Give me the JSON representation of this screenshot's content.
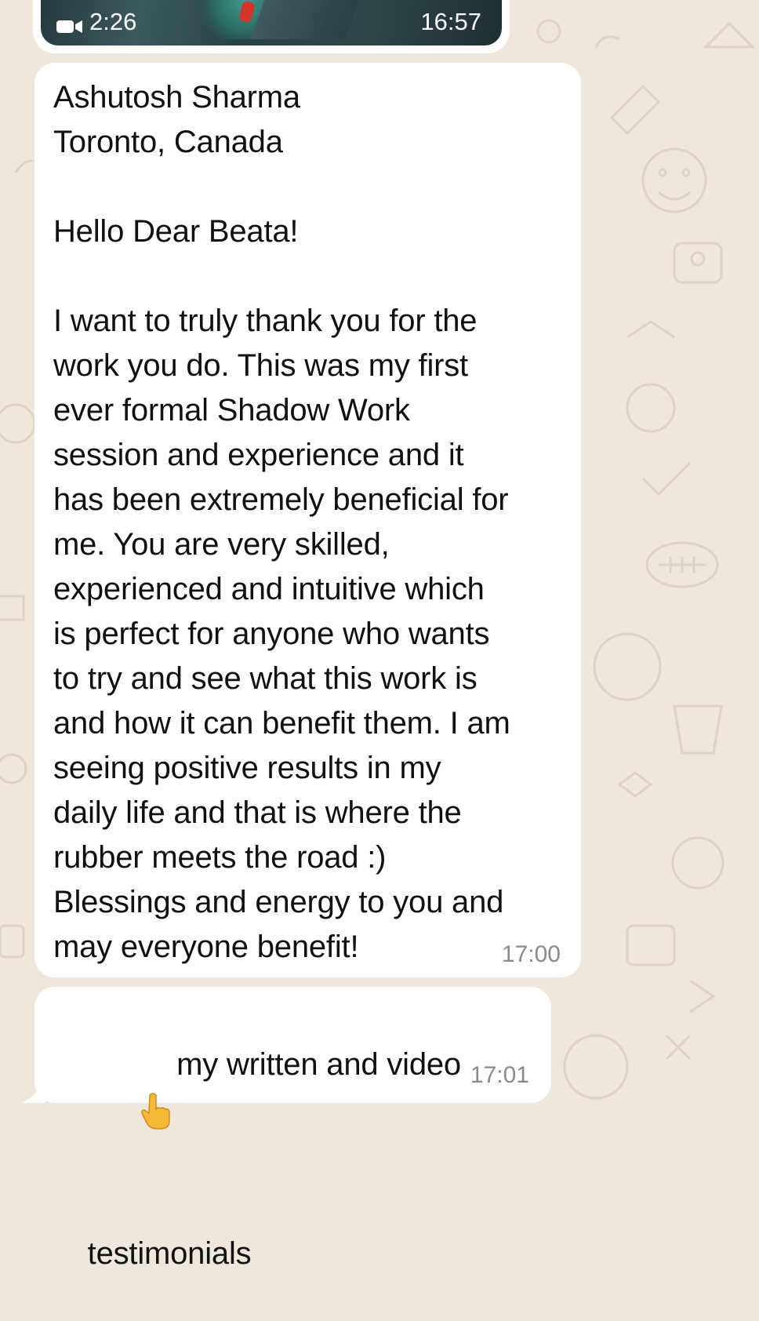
{
  "video_message": {
    "duration": "2:26",
    "time": "16:57",
    "icon": "video-camera-icon"
  },
  "message_main": {
    "text": "Ashutosh Sharma\nToronto, Canada\n\nHello Dear Beata!\n\nI want to truly thank you for the\nwork you do. This was my first\never formal Shadow Work\nsession and experience and it\nhas been extremely beneficial for\nme. You are very skilled,\nexperienced and intuitive which\nis perfect for anyone who wants\nto try and see what this work is\nand how it can benefit them. I am\nseeing positive results in my\ndaily life and that is where the\nrubber meets the road :)\nBlessings and energy to you and\nmay everyone benefit!",
    "time": "17:00"
  },
  "message_second": {
    "emoji": "pointing-up-hand-icon",
    "line1": "my written and video",
    "line2": "testimonials",
    "time": "17:01"
  },
  "colors": {
    "wallpaper": "#efe7dc",
    "bubble": "#ffffff",
    "timestamp": "#8b8b8b",
    "text": "#111111"
  }
}
